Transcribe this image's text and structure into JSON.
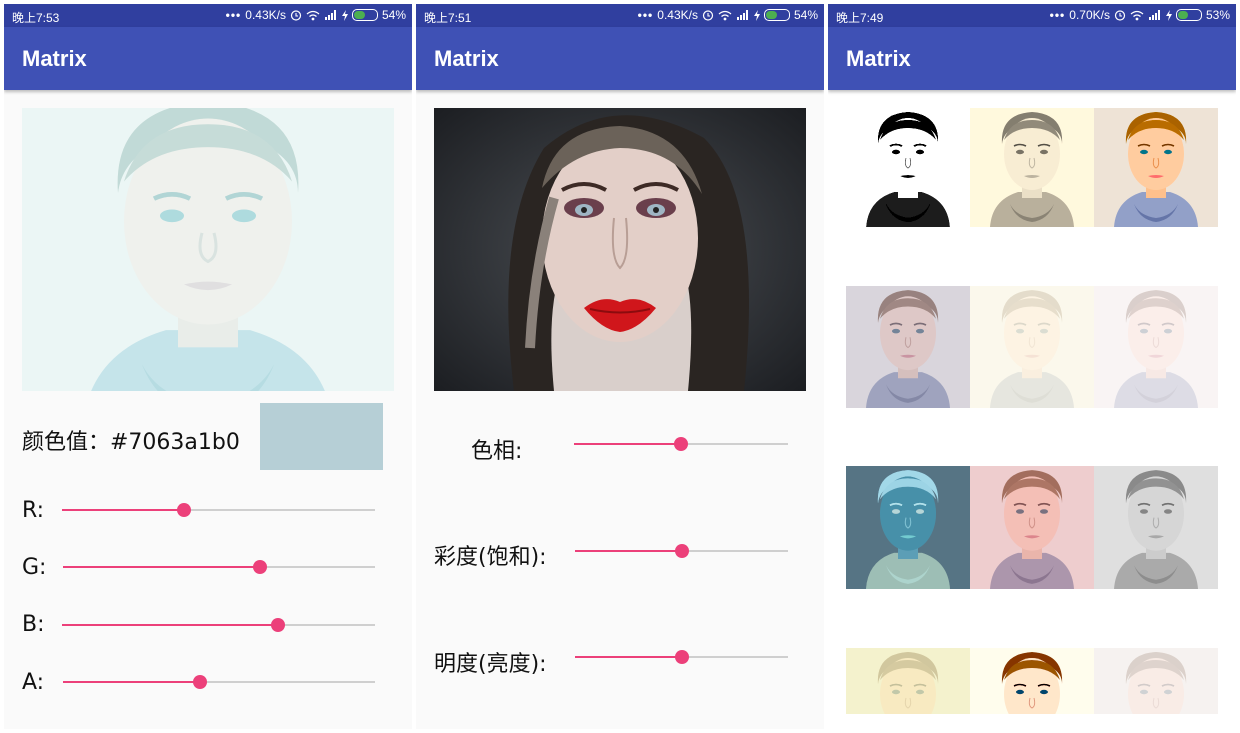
{
  "app_title": "Matrix",
  "screens": [
    {
      "status": {
        "time": "晚上7:53",
        "speed": "0.43K/s",
        "battery": "54%"
      },
      "color_label": "颜色值：#7063a1b0",
      "swatch_color": "#b6cfd6",
      "sliders": [
        {
          "label": "R:",
          "value": 0.39
        },
        {
          "label": "G:",
          "value": 0.63
        },
        {
          "label": "B:",
          "value": 0.69
        },
        {
          "label": "A:",
          "value": 0.44
        }
      ]
    },
    {
      "status": {
        "time": "晚上7:51",
        "speed": "0.43K/s",
        "battery": "54%"
      },
      "sliders": [
        {
          "label": "色相:",
          "value": 0.5
        },
        {
          "label": "彩度(饱和):",
          "value": 0.5
        },
        {
          "label": "明度(亮度):",
          "value": 0.5
        }
      ]
    },
    {
      "status": {
        "time": "晚上7:49",
        "speed": "0.70K/s",
        "battery": "53%"
      },
      "filters": [
        "sketch",
        "sepia",
        "vivid",
        "cool-gray",
        "overexposed-warm",
        "bright",
        "negative",
        "pink-tint",
        "grayscale",
        "yellow-tint",
        "high-contrast",
        "faded"
      ]
    }
  ],
  "colors": {
    "statusbar": "#303f9f",
    "appbar": "#3f51b5",
    "accent": "#ec407a"
  }
}
